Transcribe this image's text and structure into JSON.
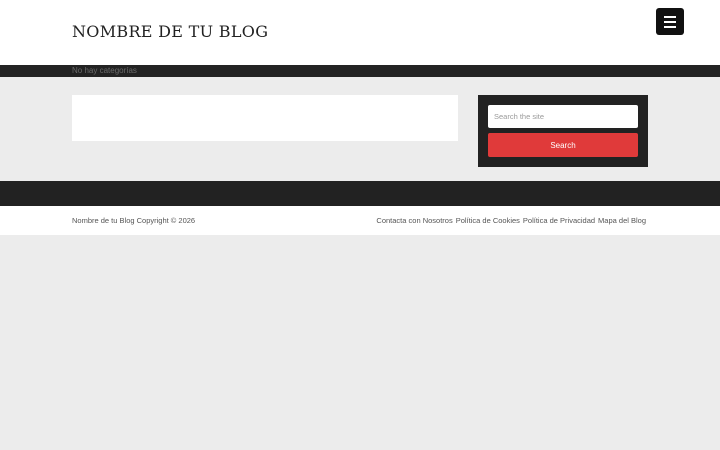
{
  "header": {
    "site_title": "NOMBRE DE TU BLOG",
    "menu_icon": "hamburger-menu-icon"
  },
  "nav": {
    "no_categories": "No hay categorías"
  },
  "sidebar": {
    "search_placeholder": "Search the site",
    "search_value": "",
    "search_button": "Search"
  },
  "footer": {
    "copyright": "Nombre de tu Blog Copyright © 2026",
    "links": [
      "Contacta con Nosotros",
      "Política de Cookies",
      "Política de Privacidad",
      "Mapa del Blog"
    ]
  },
  "colors": {
    "accent": "#e03a3a",
    "dark": "#222222",
    "background": "#ececec"
  }
}
